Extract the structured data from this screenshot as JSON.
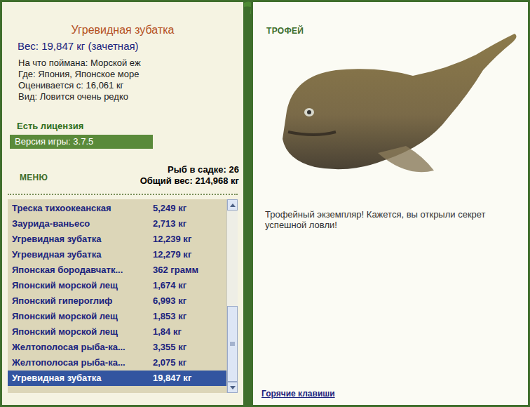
{
  "fish": {
    "name": "Угревидная зубатка",
    "weight": "Вес: 19,847 кг (зачетная)",
    "details": [
      "На что поймана: Морской еж",
      "Где: Япония, Японское море",
      "Оценивается с: 16,061 кг",
      "Вид: Ловится очень редко"
    ]
  },
  "license": "Есть лицензия",
  "version": "Версия игры: 3.7.5",
  "menu": "МЕНЮ",
  "keepnet": {
    "count": "Рыб в садке: 26",
    "total": "Общий вес: 214,968 кг"
  },
  "catch_list": [
    {
      "name": "Треска тихоокеанская",
      "weight": "5,249 кг",
      "selected": false
    },
    {
      "name": "Заурида-ваньесо",
      "weight": "2,713 кг",
      "selected": false
    },
    {
      "name": "Угревидная зубатка",
      "weight": "12,239 кг",
      "selected": false
    },
    {
      "name": "Угревидная зубатка",
      "weight": "12,279 кг",
      "selected": false
    },
    {
      "name": "Японская бородавчатк...",
      "weight": "362 грамм",
      "selected": false
    },
    {
      "name": "Японский морской лещ",
      "weight": "1,674 кг",
      "selected": false
    },
    {
      "name": "Японский гипероглиф",
      "weight": "6,993 кг",
      "selected": false
    },
    {
      "name": "Японский морской лещ",
      "weight": "1,853 кг",
      "selected": false
    },
    {
      "name": "Японский морской лещ",
      "weight": "1,84 кг",
      "selected": false
    },
    {
      "name": "Желтополосая рыба-ка...",
      "weight": "3,355 кг",
      "selected": false
    },
    {
      "name": "Желтополосая рыба-ка...",
      "weight": "2,075 кг",
      "selected": false
    },
    {
      "name": "Угревидная зубатка",
      "weight": "19,847 кг",
      "selected": true
    }
  ],
  "scrollbar": {
    "level": 1
  },
  "trophy": {
    "label": "ТРОФЕЙ",
    "message": "Трофейный экземпляр! Кажется, вы открыли секрет успешной ловли!"
  },
  "hotkeys": "Горячие клавиши"
}
